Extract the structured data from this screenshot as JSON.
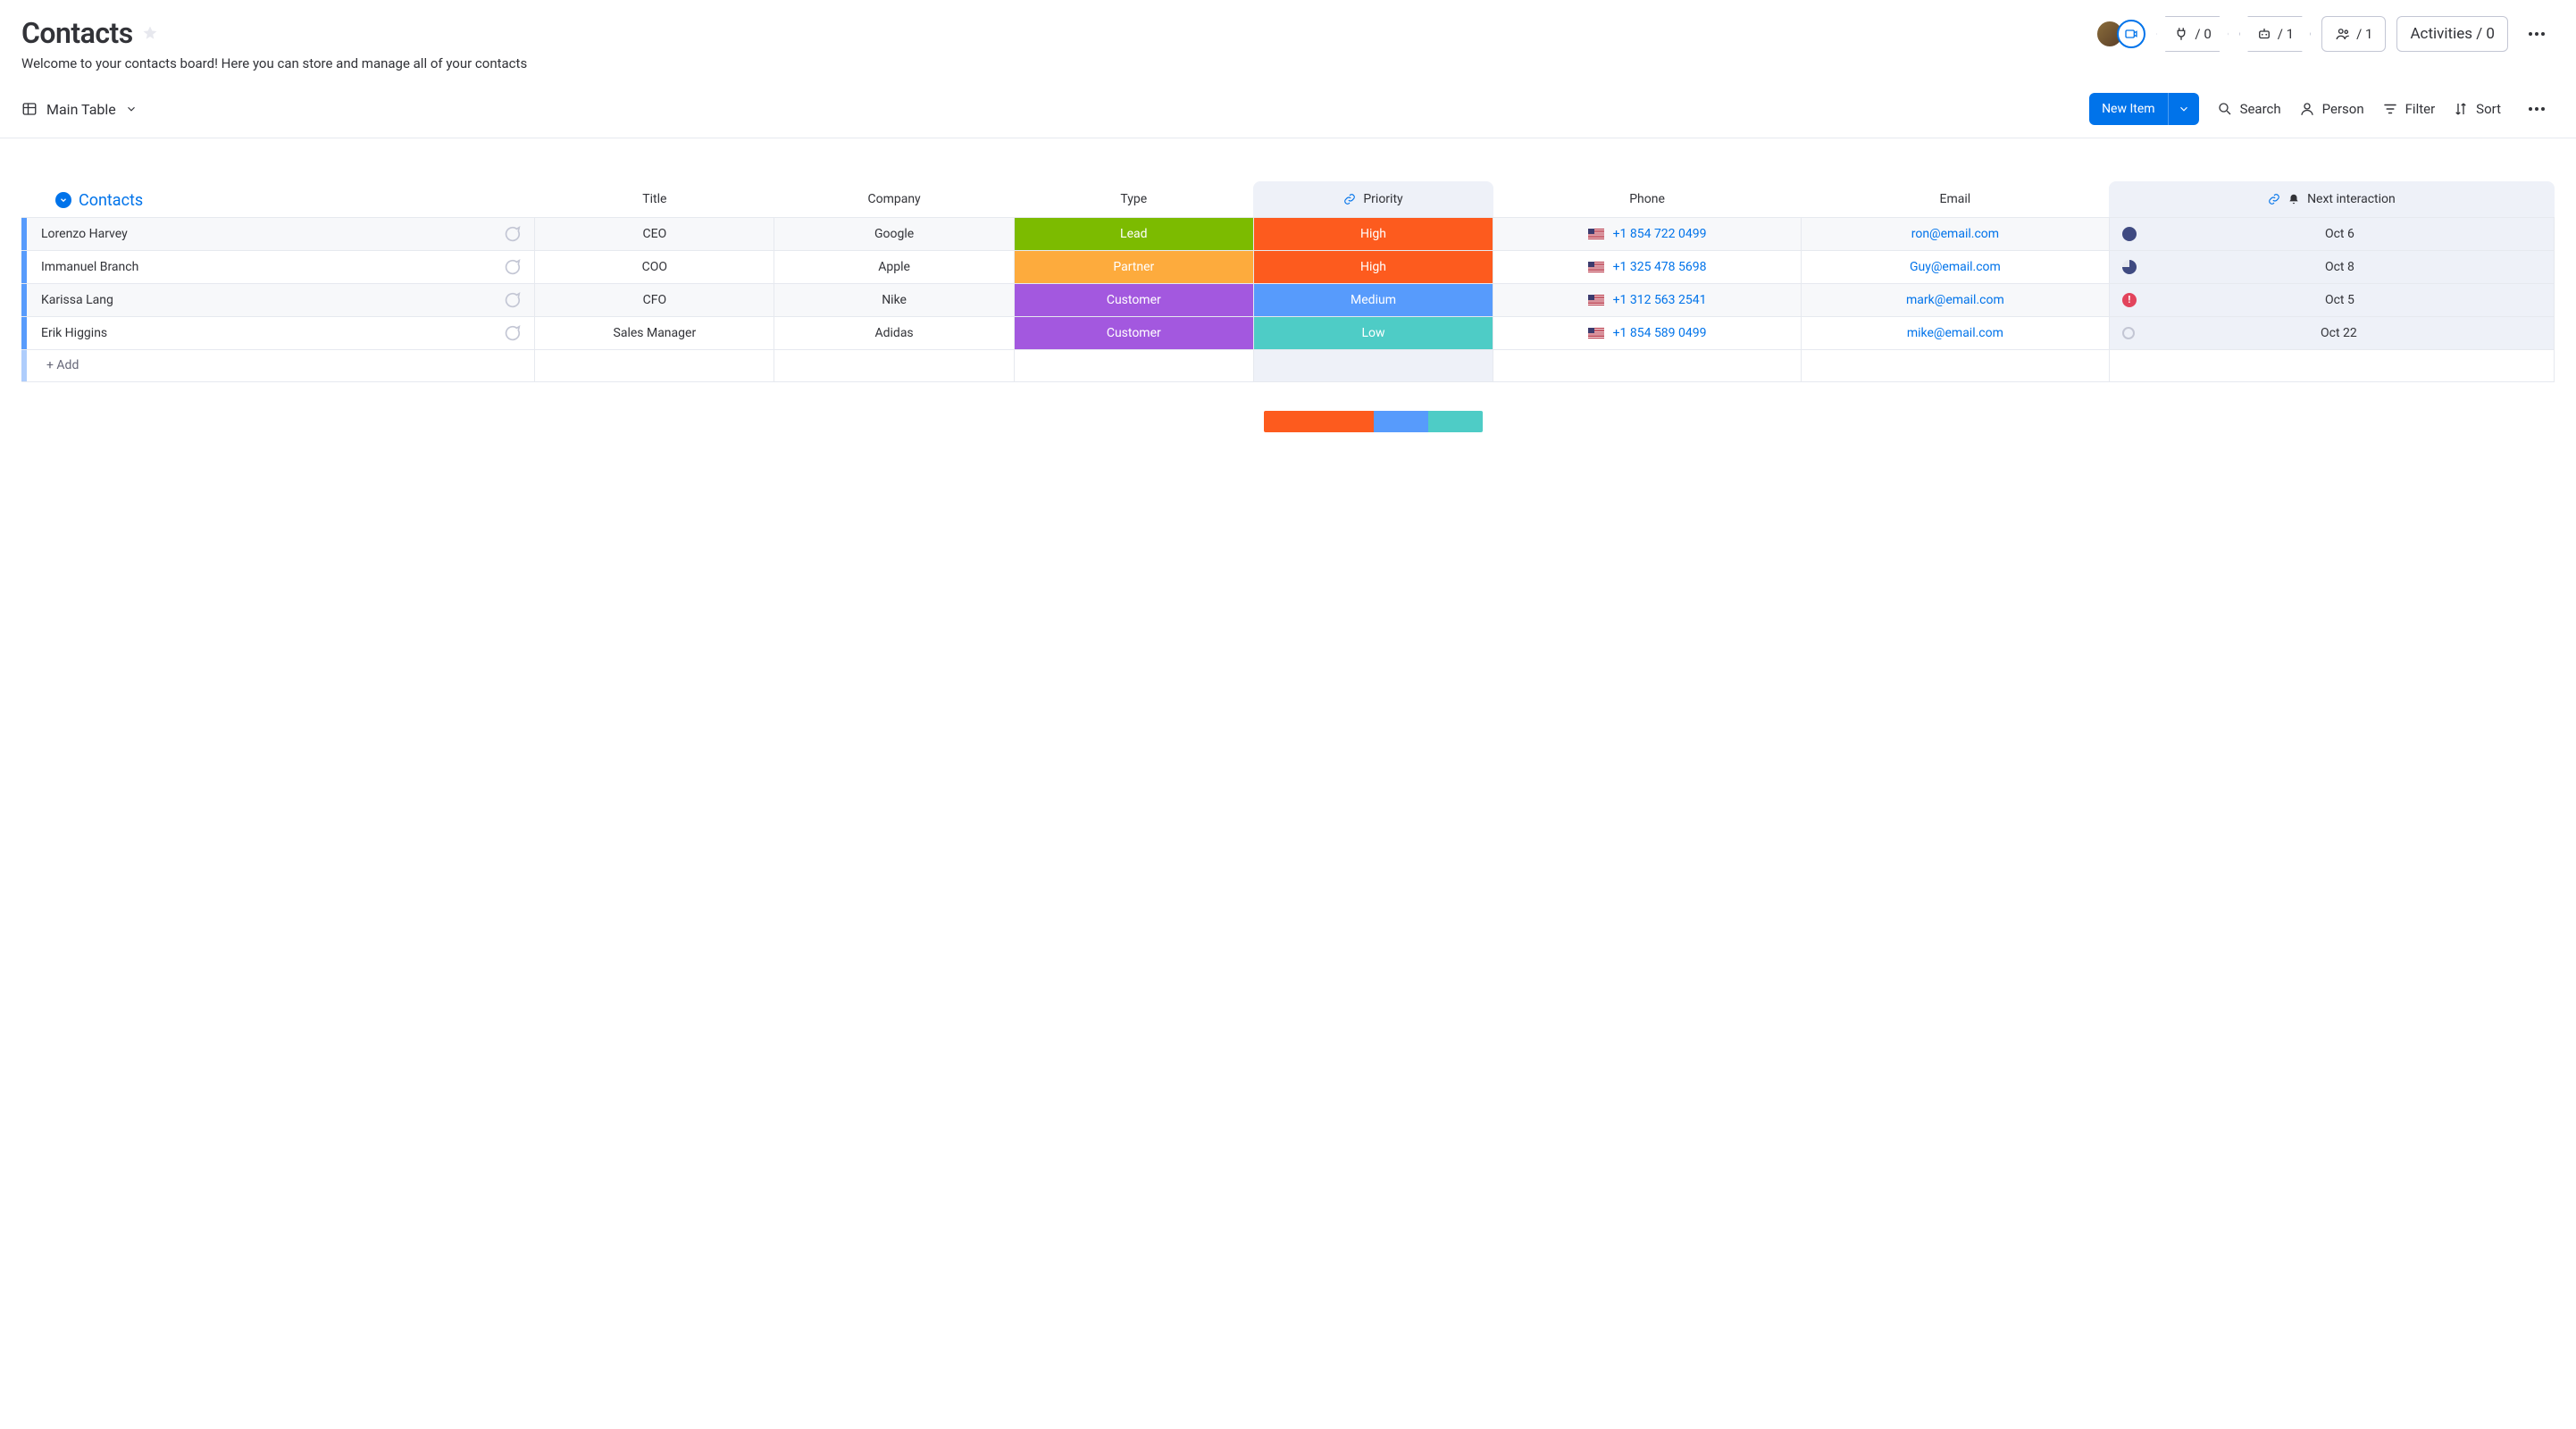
{
  "header": {
    "title": "Contacts",
    "subtitle": "Welcome to your contacts board! Here you can store and manage all of your contacts",
    "integrations_count": "/ 0",
    "automations_count": "/ 1",
    "members_count": "/ 1",
    "activities_label": "Activities / 0"
  },
  "toolbar": {
    "view_label": "Main Table",
    "new_item_label": "New Item",
    "search_label": "Search",
    "person_label": "Person",
    "filter_label": "Filter",
    "sort_label": "Sort"
  },
  "group": {
    "name": "Contacts",
    "add_label": "+ Add"
  },
  "columns": {
    "title": "Title",
    "company": "Company",
    "type": "Type",
    "priority": "Priority",
    "phone": "Phone",
    "email": "Email",
    "next": "Next interaction"
  },
  "rows": [
    {
      "name": "Lorenzo Harvey",
      "title": "CEO",
      "company": "Google",
      "type": "Lead",
      "type_class": "tag-lead",
      "priority": "High",
      "priority_class": "pri-high",
      "phone": "+1 854 722 0499",
      "email": "ron@email.com",
      "status_class": "status-full",
      "status_glyph": "",
      "next": "Oct 6"
    },
    {
      "name": "Immanuel Branch",
      "title": "COO",
      "company": "Apple",
      "type": "Partner",
      "type_class": "tag-partner",
      "priority": "High",
      "priority_class": "pri-high",
      "phone": "+1 325 478 5698",
      "email": "Guy@email.com",
      "status_class": "status-three-quarter",
      "status_glyph": "",
      "next": "Oct 8"
    },
    {
      "name": "Karissa Lang",
      "title": "CFO",
      "company": "Nike",
      "type": "Customer",
      "type_class": "tag-customer",
      "priority": "Medium",
      "priority_class": "pri-medium",
      "phone": "+1 312 563 2541",
      "email": "mark@email.com",
      "status_class": "status-alert",
      "status_glyph": "!",
      "next": "Oct 5"
    },
    {
      "name": "Erik Higgins",
      "title": "Sales Manager",
      "company": "Adidas",
      "type": "Customer",
      "type_class": "tag-customer",
      "priority": "Low",
      "priority_class": "pri-low",
      "phone": "+1 854 589 0499",
      "email": "mike@email.com",
      "status_class": "status-empty",
      "status_glyph": "",
      "next": "Oct 22"
    }
  ],
  "priority_summary": [
    {
      "class": "pri-high",
      "pct": 50
    },
    {
      "class": "pri-medium",
      "pct": 25
    },
    {
      "class": "pri-low",
      "pct": 25
    }
  ]
}
